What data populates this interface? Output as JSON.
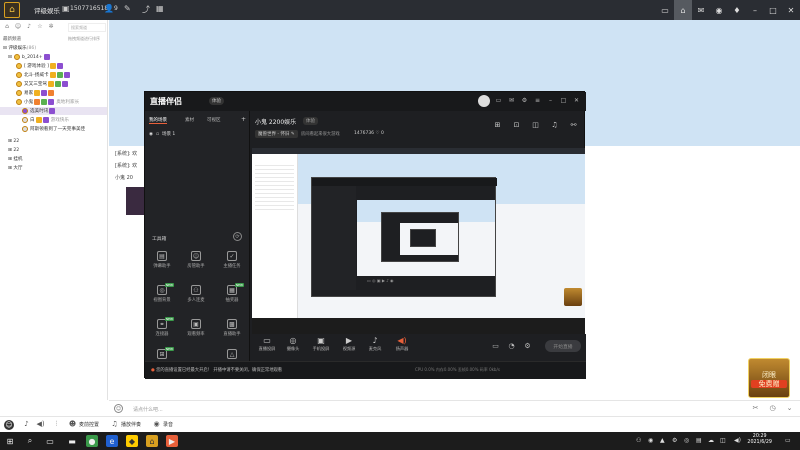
{
  "topbar": {
    "name": "评级娱乐",
    "id": "1507716518",
    "user_count": "9",
    "right_icons": [
      "screen-icon",
      "home-icon",
      "message-icon",
      "game-icon",
      "skin-icon",
      "minimize-icon",
      "maximize-icon",
      "close-icon"
    ]
  },
  "left": {
    "search_placeholder": "搜索频道",
    "section": "最新频道",
    "section_hint": "拖拽频道进行排序",
    "rows": [
      {
        "label": "评级娱乐",
        "extra": "(86)"
      },
      {
        "label": "b_2014+",
        "extra": ""
      },
      {
        "label": "[ 游戏体验 ]",
        "extra": ""
      },
      {
        "label": "北斗-扬威卡",
        "extra": ""
      },
      {
        "label": "又又三宝驾",
        "extra": ""
      },
      {
        "label": "易家",
        "extra": ""
      },
      {
        "label": "小鬼",
        "extra": "奥地利家长"
      },
      {
        "label": "选美时讯",
        "extra": ""
      },
      {
        "label": "白",
        "extra": "游戏快乐"
      },
      {
        "label": "阿斯顿看到了一天完事美佳",
        "extra": ""
      },
      {
        "label": "22",
        "extra": ""
      },
      {
        "label": "22",
        "extra": ""
      },
      {
        "label": "挂机",
        "extra": ""
      },
      {
        "label": "大厅",
        "extra": ""
      }
    ]
  },
  "chat": {
    "lines": [
      "[系统]: 欢",
      "[系统]: 欢",
      "小鬼 20"
    ]
  },
  "app": {
    "logo": "直播伴侣",
    "version": "体验",
    "tabs": [
      "我的场景",
      "素材",
      "可视区"
    ],
    "scene": "场景 1",
    "tools_label": "工具箱",
    "tools": [
      {
        "label": "弹幕助手",
        "icon": "danmaku-icon",
        "new": false
      },
      {
        "label": "房管助手",
        "icon": "admin-icon",
        "new": false
      },
      {
        "label": "主播任务",
        "icon": "task-icon",
        "new": false
      },
      {
        "label": "视图背景",
        "icon": "view-icon",
        "new": true
      },
      {
        "label": "多人连麦",
        "icon": "multi-icon",
        "new": false
      },
      {
        "label": "抽奖器",
        "icon": "lottery-icon",
        "new": true
      },
      {
        "label": "连接器",
        "icon": "connect-icon",
        "new": true
      },
      {
        "label": "观看频率",
        "icon": "calendar-icon",
        "new": false
      },
      {
        "label": "直播助手",
        "icon": "assist-icon",
        "new": false
      },
      {
        "label": "礼物设置",
        "icon": "gift-icon",
        "new": true
      },
      {
        "label": "更多",
        "icon": "more-icon",
        "new": false
      }
    ],
    "title": "小鬼 2200娱乐",
    "title_badge": "体验",
    "game": "魔兽世界 - 怀旧",
    "room": "房间看起来很大游戏",
    "heat": "1476736",
    "heat_suffix": "0",
    "bottom_buttons": [
      {
        "label": "直播投屏",
        "icon": "cast-icon"
      },
      {
        "label": "摄像头",
        "icon": "camera-icon"
      },
      {
        "label": "手机投屏",
        "icon": "phone-icon"
      },
      {
        "label": "视频源",
        "icon": "video-icon"
      },
      {
        "label": "麦克风",
        "icon": "mic-icon"
      },
      {
        "label": "扬声器",
        "icon": "speaker-icon"
      }
    ],
    "start_label": "开始直播",
    "status_text": "您的直播设置已经最大开启！ 开播中请不要关闭，确保正常地观看",
    "stats": "CPU 0.0%  内存0.00%  丢帧0.00%  码率 0kb/s"
  },
  "gift": {
    "line1": "闭眼",
    "line2": "免费赠"
  },
  "input": {
    "placeholder": "请点什么吧..."
  },
  "bottom": [
    {
      "label": "",
      "icon": "avatar-icon"
    },
    {
      "label": "",
      "icon": "mic-icon"
    },
    {
      "label": "",
      "icon": "speaker-icon"
    },
    {
      "label": "",
      "icon": "mixer-icon"
    },
    {
      "label": "麦前控置",
      "icon": "face-icon"
    },
    {
      "label": "播放伴奏",
      "icon": "music-icon"
    },
    {
      "label": "录音",
      "icon": "record-icon"
    }
  ],
  "taskbar": {
    "time": "20:29",
    "date": "2021/6/29"
  }
}
